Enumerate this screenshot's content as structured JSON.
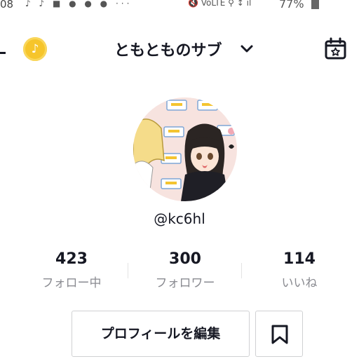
{
  "status_bar": {
    "time": "08",
    "icons": "♪ ♪ ■ ● ● ● ···",
    "right_icons": "🔇 VoLTE ⚲ ↕ ıl",
    "battery": "77%"
  },
  "header": {
    "title": "ともとものサブ",
    "coin_icon": "tiktok-coin-icon",
    "calendar_icon": "calendar-star-icon",
    "dropdown_icon": "chevron-down-icon"
  },
  "profile": {
    "handle": "@kc6hl",
    "avatar_icon": "anime-avatar"
  },
  "stats": [
    {
      "value": "423",
      "label": "フォロー中"
    },
    {
      "value": "300",
      "label": "フォロワー"
    },
    {
      "value": "114",
      "label": "いいね"
    }
  ],
  "actions": {
    "edit_profile": "プロフィールを編集",
    "bookmark_icon": "bookmark-icon"
  },
  "colors": {
    "coin": "#f6c52b",
    "text": "#161823",
    "muted": "#8a8b91",
    "border": "#d0d1d3"
  }
}
